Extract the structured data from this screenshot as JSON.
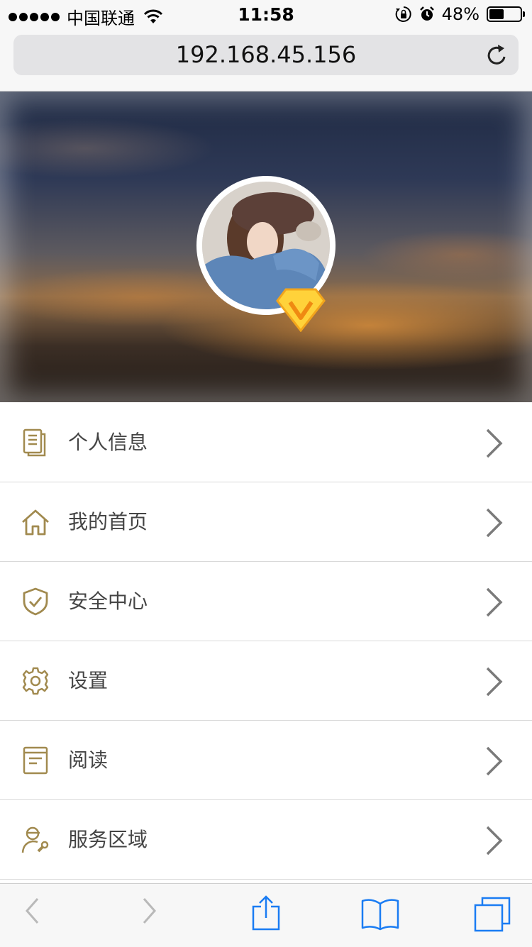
{
  "status_bar": {
    "carrier": "中国联通",
    "time": "11:58",
    "battery_text": "48%",
    "battery_level": 0.48
  },
  "browser": {
    "url": "192.168.45.156"
  },
  "profile": {
    "avatar_icon": "avatar-photo",
    "badge_icon": "vip-diamond-icon"
  },
  "menu": {
    "items": [
      {
        "label": "个人信息",
        "icon": "document-icon"
      },
      {
        "label": "我的首页",
        "icon": "home-icon"
      },
      {
        "label": "安全中心",
        "icon": "shield-check-icon"
      },
      {
        "label": "设置",
        "icon": "gear-icon"
      },
      {
        "label": "阅读",
        "icon": "book-icon"
      },
      {
        "label": "服务区域",
        "icon": "user-wrench-icon"
      }
    ]
  },
  "colors": {
    "accent_gold": "#a18a4f",
    "chevron": "#7a7a7a",
    "ios_blue": "#1a7cf3"
  }
}
